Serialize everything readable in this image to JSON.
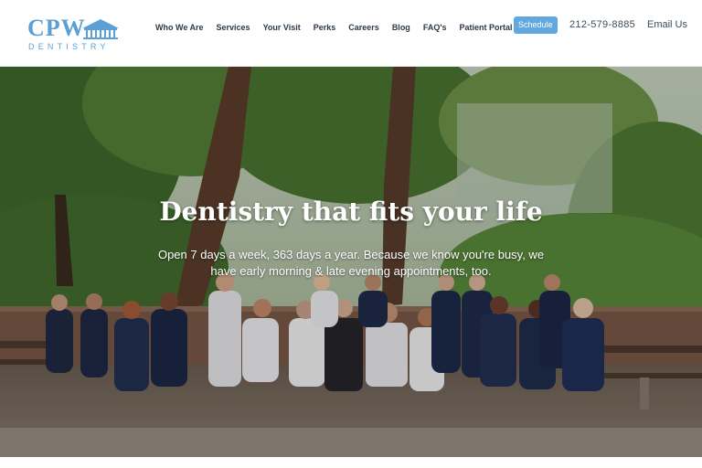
{
  "brand": {
    "logo_text": "CPW",
    "logo_sub": "DENTISTRY",
    "color": "#5aa0d6"
  },
  "nav": {
    "items": [
      {
        "label": "Who We Are"
      },
      {
        "label": "Services"
      },
      {
        "label": "Your Visit"
      },
      {
        "label": "Perks"
      },
      {
        "label": "Careers"
      },
      {
        "label": "Blog"
      },
      {
        "label": "FAQ's"
      },
      {
        "label": "Patient Portal"
      }
    ]
  },
  "header": {
    "schedule_label": "Schedule",
    "phone": "212-579-8885",
    "email_label": "Email Us",
    "accent": "#62a8e0"
  },
  "hero": {
    "title": "Dentistry that fits your life",
    "subtitle": "Open 7 days a week, 363 days a year. Because we know you're busy, we have early morning & late evening appointments, too."
  }
}
